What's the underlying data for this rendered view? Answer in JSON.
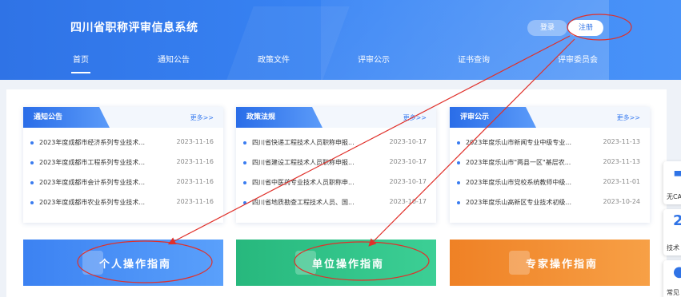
{
  "header": {
    "title": "四川省职称评审信息系统",
    "login_label": "登录",
    "register_label": "注册"
  },
  "nav": {
    "items": [
      {
        "label": "首页"
      },
      {
        "label": "通知公告"
      },
      {
        "label": "政策文件"
      },
      {
        "label": "评审公示"
      },
      {
        "label": "证书查询"
      },
      {
        "label": "评审委员会"
      }
    ]
  },
  "cards": [
    {
      "tab": "通知公告",
      "more": "更多>>",
      "rows": [
        {
          "title": "2023年度成都市经济系列专业技术...",
          "date": "2023-11-16"
        },
        {
          "title": "2023年度成都市工程系列专业技术...",
          "date": "2023-11-16"
        },
        {
          "title": "2023年度成都市会计系列专业技术...",
          "date": "2023-11-16"
        },
        {
          "title": "2023年度成都市农业系列专业技术...",
          "date": "2023-11-16"
        }
      ]
    },
    {
      "tab": "政策法规",
      "more": "更多>>",
      "rows": [
        {
          "title": "四川省快递工程技术人员职称申报...",
          "date": "2023-10-17"
        },
        {
          "title": "四川省建设工程技术人员职称申报...",
          "date": "2023-10-17"
        },
        {
          "title": "四川省中医药专业技术人员职称申...",
          "date": "2023-10-17"
        },
        {
          "title": "四川省地质勘查工程技术人员、国...",
          "date": "2023-10-17"
        }
      ]
    },
    {
      "tab": "评审公示",
      "more": "更多>>",
      "rows": [
        {
          "title": "2023年度乐山市新闻专业中级专业...",
          "date": "2023-11-13"
        },
        {
          "title": "2023年度乐山市\"两县一区\"基层农...",
          "date": "2023-11-13"
        },
        {
          "title": "2023年度乐山市党校系统教师中级...",
          "date": "2023-11-01"
        },
        {
          "title": "2023年度乐山高新区专业技术初级...",
          "date": "2023-10-24"
        }
      ]
    }
  ],
  "guides": {
    "personal": "个人操作指南",
    "unit": "单位操作指南",
    "expert": "专家操作指南"
  },
  "side": {
    "item1": "无CA",
    "item2_glyph": "2",
    "item2": "技术",
    "item3": "常见"
  },
  "colors": {
    "header": "#2f73e6",
    "accent": "#3a7cf0",
    "green": "#27b87d",
    "orange": "#ef8125",
    "annotation": "#e0302a"
  }
}
